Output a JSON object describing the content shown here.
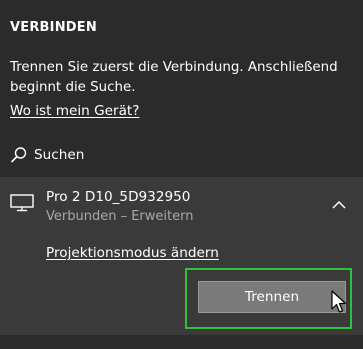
{
  "panel": {
    "header": "VERBINDEN",
    "message": "Trennen Sie zuerst die Verbindung. Anschließend beginnt die Suche.",
    "help_link": "Wo ist mein Gerät?",
    "search_label": "Suchen"
  },
  "device": {
    "name": "Pro 2 D10_5D932950",
    "status": "Verbunden – Erweitern",
    "projection_link": "Projektionsmodus ändern",
    "disconnect_label": "Trennen"
  },
  "icons": {
    "search": "search-icon",
    "device": "monitor-icon",
    "expand": "chevron-up-icon",
    "cursor": "mouse-pointer-icon"
  },
  "colors": {
    "background": "#2b2b2b",
    "device_panel": "#3a3a3a",
    "button": "#7a7a7a",
    "highlight": "#2ec13b",
    "secondary_text": "#a8a8a8"
  }
}
